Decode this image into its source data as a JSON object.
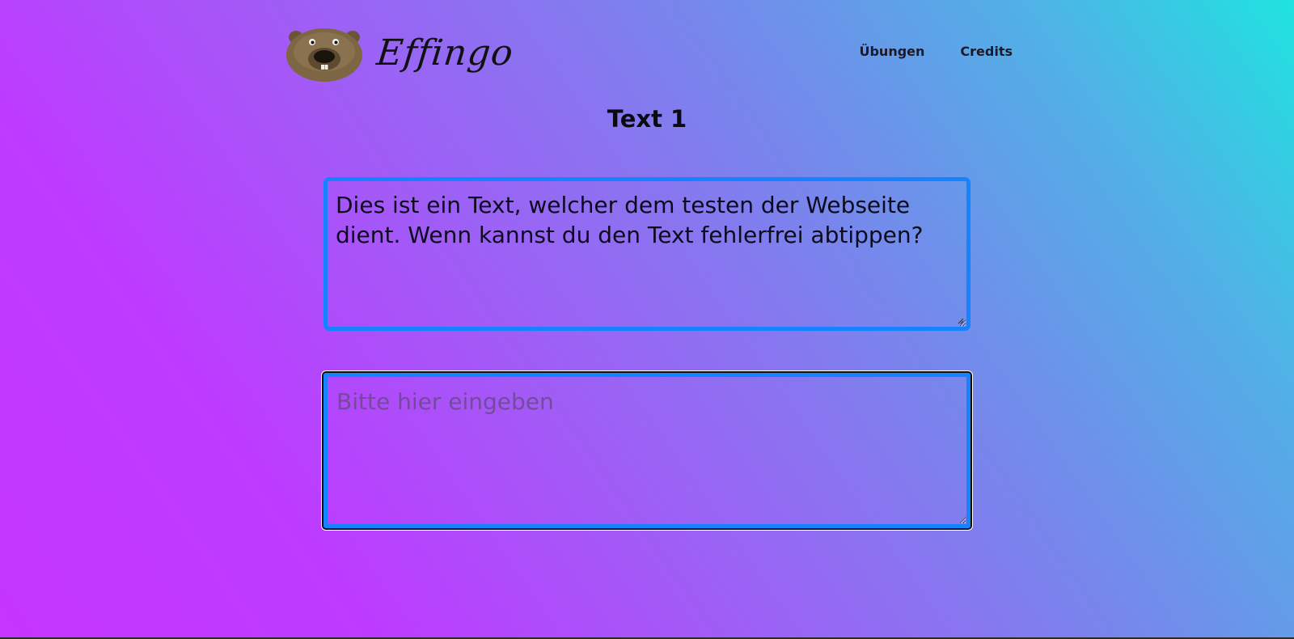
{
  "brand": {
    "name": "Effingo",
    "logo_icon": "beaver-head-icon"
  },
  "nav": {
    "items": [
      {
        "label": "Übungen"
      },
      {
        "label": "Credits"
      }
    ]
  },
  "page": {
    "title": "Text 1"
  },
  "exercise": {
    "source_text": "Dies ist ein Text, welcher dem testen der Webseite dient. Wenn kannst du den Text fehlerfrei abtippen?",
    "input_value": "",
    "input_placeholder": "Bitte hier eingeben"
  },
  "colors": {
    "gradient_start": "#c536ff",
    "gradient_end": "#1fe3e0",
    "box_border": "#1582ff"
  }
}
